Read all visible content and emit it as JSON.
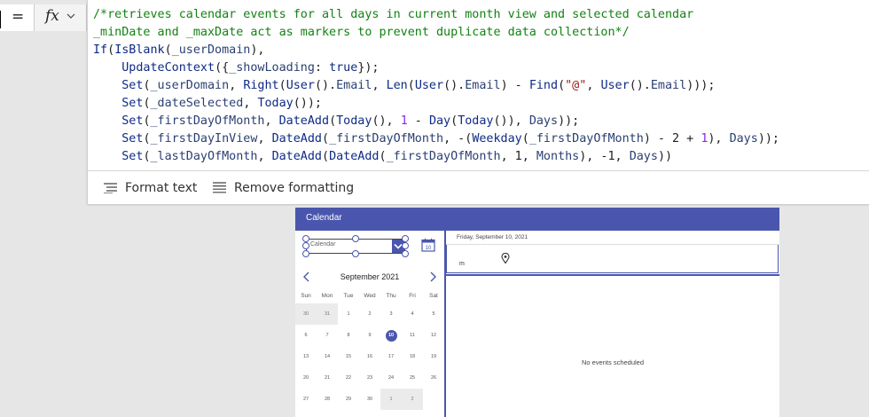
{
  "formula_bar": {
    "equals": "=",
    "fx_label": "fx",
    "lines": [
      [
        {
          "t": "/*retrieves calendar events for all days in current month view and selected calendar",
          "c": "comment"
        }
      ],
      [
        {
          "t": "_minDate and _maxDate act as markers to prevent duplicate data collection*/",
          "c": "comment"
        }
      ],
      [
        {
          "t": "If",
          "c": "ctrl"
        },
        {
          "t": "(",
          "c": ""
        },
        {
          "t": "IsBlank",
          "c": "fn"
        },
        {
          "t": "(",
          "c": ""
        },
        {
          "t": "_userDomain",
          "c": "var"
        },
        {
          "t": "),",
          "c": ""
        }
      ],
      [
        {
          "t": "    ",
          "c": ""
        },
        {
          "t": "UpdateContext",
          "c": "fn"
        },
        {
          "t": "({",
          "c": ""
        },
        {
          "t": "_showLoading",
          "c": "var"
        },
        {
          "t": ": ",
          "c": ""
        },
        {
          "t": "true",
          "c": "key"
        },
        {
          "t": "});",
          "c": ""
        }
      ],
      [
        {
          "t": "    ",
          "c": ""
        },
        {
          "t": "Set",
          "c": "fn"
        },
        {
          "t": "(",
          "c": ""
        },
        {
          "t": "_userDomain",
          "c": "var"
        },
        {
          "t": ", ",
          "c": ""
        },
        {
          "t": "Right",
          "c": "fn"
        },
        {
          "t": "(",
          "c": ""
        },
        {
          "t": "User",
          "c": "fn"
        },
        {
          "t": "().",
          "c": ""
        },
        {
          "t": "Email",
          "c": "var"
        },
        {
          "t": ", ",
          "c": ""
        },
        {
          "t": "Len",
          "c": "fn"
        },
        {
          "t": "(",
          "c": ""
        },
        {
          "t": "User",
          "c": "fn"
        },
        {
          "t": "().",
          "c": ""
        },
        {
          "t": "Email",
          "c": "var"
        },
        {
          "t": ") - ",
          "c": ""
        },
        {
          "t": "Find",
          "c": "fn"
        },
        {
          "t": "(",
          "c": ""
        },
        {
          "t": "\"@\"",
          "c": "str"
        },
        {
          "t": ", ",
          "c": ""
        },
        {
          "t": "User",
          "c": "fn"
        },
        {
          "t": "().",
          "c": ""
        },
        {
          "t": "Email",
          "c": "var"
        },
        {
          "t": ")));",
          "c": ""
        }
      ],
      [
        {
          "t": "    ",
          "c": ""
        },
        {
          "t": "Set",
          "c": "fn"
        },
        {
          "t": "(",
          "c": ""
        },
        {
          "t": "_dateSelected",
          "c": "var"
        },
        {
          "t": ", ",
          "c": ""
        },
        {
          "t": "Today",
          "c": "fn"
        },
        {
          "t": "());",
          "c": ""
        }
      ],
      [
        {
          "t": "    ",
          "c": ""
        },
        {
          "t": "Set",
          "c": "fn"
        },
        {
          "t": "(",
          "c": ""
        },
        {
          "t": "_firstDayOfMonth",
          "c": "var"
        },
        {
          "t": ", ",
          "c": ""
        },
        {
          "t": "DateAdd",
          "c": "fn"
        },
        {
          "t": "(",
          "c": ""
        },
        {
          "t": "Today",
          "c": "fn"
        },
        {
          "t": "(), ",
          "c": ""
        },
        {
          "t": "1",
          "c": "num"
        },
        {
          "t": " - ",
          "c": ""
        },
        {
          "t": "Day",
          "c": "fn"
        },
        {
          "t": "(",
          "c": ""
        },
        {
          "t": "Today",
          "c": "fn"
        },
        {
          "t": "()), ",
          "c": ""
        },
        {
          "t": "Days",
          "c": "var"
        },
        {
          "t": "));",
          "c": ""
        }
      ],
      [
        {
          "t": "    ",
          "c": ""
        },
        {
          "t": "Set",
          "c": "fn"
        },
        {
          "t": "(",
          "c": ""
        },
        {
          "t": "_firstDayInView",
          "c": "var"
        },
        {
          "t": ", ",
          "c": ""
        },
        {
          "t": "DateAdd",
          "c": "fn"
        },
        {
          "t": "(",
          "c": ""
        },
        {
          "t": "_firstDayOfMonth",
          "c": "var"
        },
        {
          "t": ", -(",
          "c": ""
        },
        {
          "t": "Weekday",
          "c": "fn"
        },
        {
          "t": "(",
          "c": ""
        },
        {
          "t": "_firstDayOfMonth",
          "c": "var"
        },
        {
          "t": ") - 2 + ",
          "c": ""
        },
        {
          "t": "1",
          "c": "num"
        },
        {
          "t": "), ",
          "c": ""
        },
        {
          "t": "Days",
          "c": "var"
        },
        {
          "t": "));",
          "c": ""
        }
      ],
      [
        {
          "t": "    ",
          "c": ""
        },
        {
          "t": "Set",
          "c": "fn"
        },
        {
          "t": "(",
          "c": ""
        },
        {
          "t": "_lastDayOfMonth",
          "c": "var"
        },
        {
          "t": ", ",
          "c": ""
        },
        {
          "t": "DateAdd",
          "c": "fn"
        },
        {
          "t": "(",
          "c": ""
        },
        {
          "t": "DateAdd",
          "c": "fn"
        },
        {
          "t": "(",
          "c": ""
        },
        {
          "t": "_firstDayOfMonth",
          "c": "var"
        },
        {
          "t": ", 1, ",
          "c": ""
        },
        {
          "t": "Months",
          "c": "var"
        },
        {
          "t": "), -1, ",
          "c": ""
        },
        {
          "t": "Days",
          "c": "var"
        },
        {
          "t": "))",
          "c": ""
        }
      ]
    ],
    "toolbar": {
      "format_text": "Format text",
      "remove_formatting": "Remove formatting"
    }
  },
  "app": {
    "title": "Calendar",
    "dropdown_value": "Calendar",
    "calendar_icon_day": "10",
    "month_label": "September 2021",
    "weekdays": [
      "Sun",
      "Mon",
      "Tue",
      "Wed",
      "Thu",
      "Fri",
      "Sat"
    ],
    "days": [
      {
        "d": "30",
        "other": true
      },
      {
        "d": "31",
        "other": true
      },
      {
        "d": "1"
      },
      {
        "d": "2"
      },
      {
        "d": "3"
      },
      {
        "d": "4"
      },
      {
        "d": "5"
      },
      {
        "d": "6"
      },
      {
        "d": "7"
      },
      {
        "d": "8"
      },
      {
        "d": "9"
      },
      {
        "d": "10",
        "selected": true
      },
      {
        "d": "11"
      },
      {
        "d": "12"
      },
      {
        "d": "13"
      },
      {
        "d": "14"
      },
      {
        "d": "15"
      },
      {
        "d": "16"
      },
      {
        "d": "17"
      },
      {
        "d": "18"
      },
      {
        "d": "19"
      },
      {
        "d": "20"
      },
      {
        "d": "21"
      },
      {
        "d": "22"
      },
      {
        "d": "23"
      },
      {
        "d": "24"
      },
      {
        "d": "25"
      },
      {
        "d": "26"
      },
      {
        "d": "27"
      },
      {
        "d": "28"
      },
      {
        "d": "29"
      },
      {
        "d": "30"
      },
      {
        "d": "1",
        "other": true
      },
      {
        "d": "2",
        "other": true
      }
    ],
    "selected_date_label": "Friday, September 10, 2021",
    "event_field_text": "m",
    "no_events": "No events scheduled"
  },
  "colors": {
    "accent": "#4a56ad",
    "comment": "#128212",
    "function": "#0e2a85",
    "string": "#a31515"
  }
}
